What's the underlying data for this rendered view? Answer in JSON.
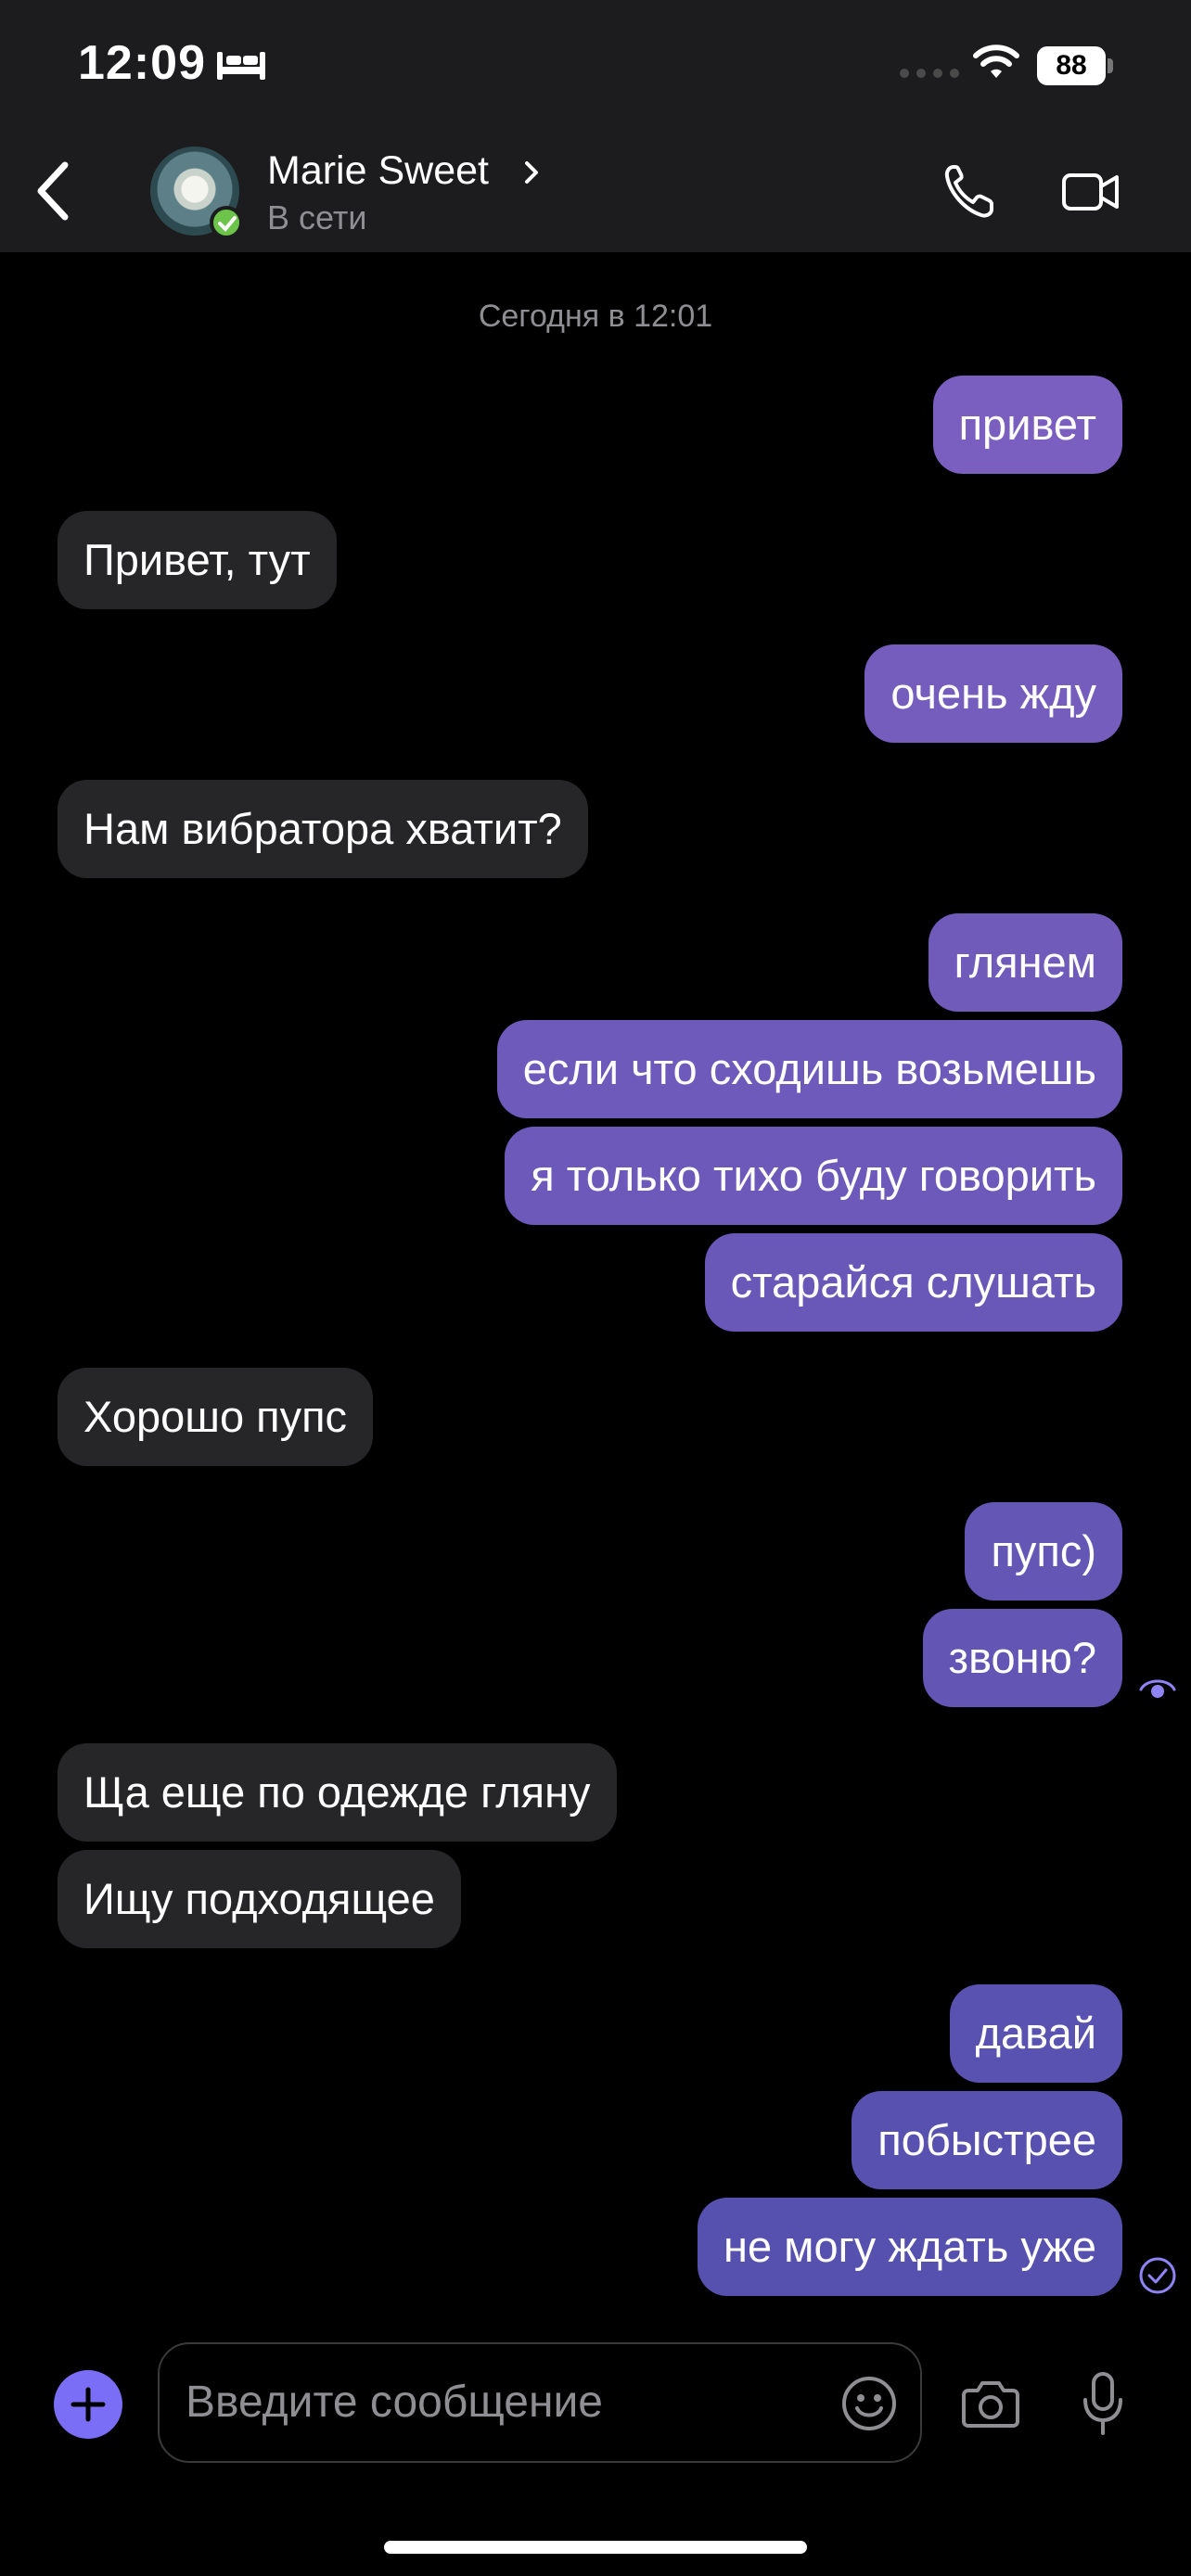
{
  "status_bar": {
    "time": "12:09",
    "battery": "88",
    "icons": [
      "bed-icon",
      "signal-icon",
      "wifi-icon",
      "battery-icon"
    ]
  },
  "header": {
    "contact_name": "Marie Sweet",
    "contact_status": "В сети",
    "icons": [
      "back-icon",
      "chevron-right-icon",
      "phone-icon",
      "video-camera-icon"
    ]
  },
  "chat": {
    "date_separator": "Сегодня в 12:01",
    "messages": [
      {
        "direction": "out",
        "text": "привет"
      },
      {
        "direction": "in",
        "text": "Привет, тут"
      },
      {
        "direction": "out",
        "text": "очень жду"
      },
      {
        "direction": "in",
        "text": "Нам вибратора хватит?"
      },
      {
        "direction": "out",
        "text": "глянем"
      },
      {
        "direction": "out",
        "text": "если что сходишь возьмешь"
      },
      {
        "direction": "out",
        "text": "я только тихо буду говорить"
      },
      {
        "direction": "out",
        "text": "старайся слушать"
      },
      {
        "direction": "in",
        "text": "Хорошо пупс"
      },
      {
        "direction": "out",
        "text": "пупс)"
      },
      {
        "direction": "out",
        "text": "звоню?",
        "status": "read"
      },
      {
        "direction": "in",
        "text": "Ща еще по одежде гляну"
      },
      {
        "direction": "in",
        "text": "Ищу подходящее"
      },
      {
        "direction": "out",
        "text": "давай"
      },
      {
        "direction": "out",
        "text": "побыстрее"
      },
      {
        "direction": "out",
        "text": "не могу ждать уже",
        "status": "delivered"
      }
    ]
  },
  "composer": {
    "placeholder": "Введите сообщение",
    "icons": [
      "plus-icon",
      "emoji-icon",
      "camera-icon",
      "microphone-icon"
    ]
  },
  "colors": {
    "outgoing_bubble_top": "#7b5fc0",
    "outgoing_bubble_bottom": "#5550ae",
    "incoming_bubble": "#262628",
    "accent": "#7b6ef6",
    "online": "#6cc44b"
  }
}
